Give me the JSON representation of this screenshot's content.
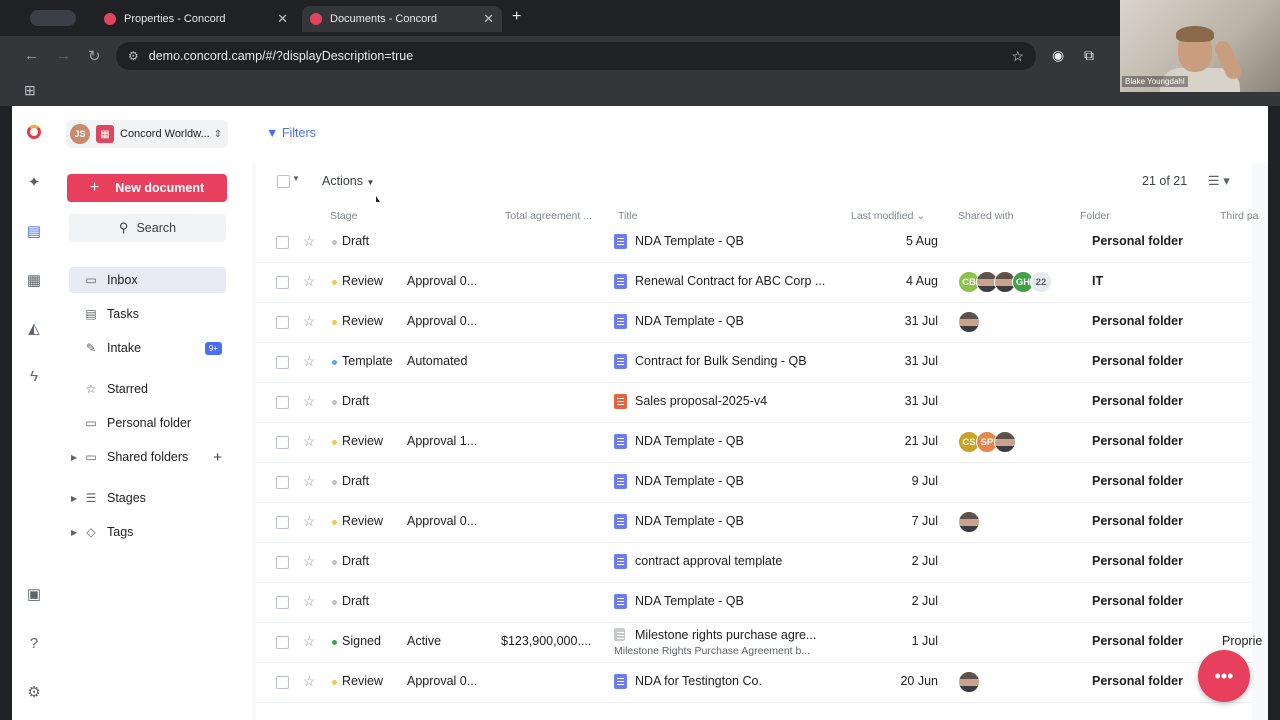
{
  "browser": {
    "tabs": [
      {
        "label": "Properties - Concord"
      },
      {
        "label": "Documents - Concord"
      }
    ],
    "url": "demo.concord.camp/#/?displayDescription=true",
    "webcam_name": "Blake Youngdahl"
  },
  "sidebar": {
    "org_initials": "JS",
    "org_name": "Concord Worldw...",
    "new_document": "New document",
    "search": "Search",
    "items": [
      {
        "label": "Inbox"
      },
      {
        "label": "Tasks"
      },
      {
        "label": "Intake",
        "badge": "9+"
      },
      {
        "label": "Starred"
      },
      {
        "label": "Personal folder"
      },
      {
        "label": "Shared folders"
      },
      {
        "label": "Stages"
      },
      {
        "label": "Tags"
      }
    ]
  },
  "main": {
    "filters": "Filters",
    "actions": "Actions",
    "count": "21 of 21",
    "headers": {
      "stage": "Stage",
      "total": "Total agreement ...",
      "title": "Title",
      "modified": "Last modified",
      "shared": "Shared with",
      "folder": "Folder",
      "third": "Third pa"
    },
    "rows": [
      {
        "stage": "Draft",
        "status": "",
        "amount": "",
        "title": "NDA Template - QB",
        "subtitle": "",
        "date": "5 Aug",
        "folder": "Personal folder"
      },
      {
        "stage": "Review",
        "status": "Approval 0...",
        "amount": "",
        "title": "Renewal Contract for ABC Corp ...",
        "subtitle": "",
        "date": "4 Aug",
        "folder": "IT",
        "shared": [
          "CB",
          "",
          "",
          "GH"
        ],
        "shared_more": "22"
      },
      {
        "stage": "Review",
        "status": "Approval 0...",
        "amount": "",
        "title": "NDA Template - QB",
        "subtitle": "",
        "date": "31 Jul",
        "folder": "Personal folder"
      },
      {
        "stage": "Template",
        "status": "Automated",
        "amount": "",
        "title": "Contract for Bulk Sending - QB",
        "subtitle": "",
        "date": "31 Jul",
        "folder": "Personal folder"
      },
      {
        "stage": "Draft",
        "status": "",
        "amount": "",
        "title": "Sales proposal-2025-v4",
        "subtitle": "",
        "date": "31 Jul",
        "folder": "Personal folder"
      },
      {
        "stage": "Review",
        "status": "Approval 1...",
        "amount": "",
        "title": "NDA Template - QB",
        "subtitle": "",
        "date": "21 Jul",
        "folder": "Personal folder",
        "shared": [
          "CS",
          "SP",
          ""
        ]
      },
      {
        "stage": "Draft",
        "status": "",
        "amount": "",
        "title": "NDA Template - QB",
        "subtitle": "",
        "date": "9 Jul",
        "folder": "Personal folder"
      },
      {
        "stage": "Review",
        "status": "Approval 0...",
        "amount": "",
        "title": "NDA Template - QB",
        "subtitle": "",
        "date": "7 Jul",
        "folder": "Personal folder"
      },
      {
        "stage": "Draft",
        "status": "",
        "amount": "",
        "title": "contract approval template",
        "subtitle": "",
        "date": "2 Jul",
        "folder": "Personal folder"
      },
      {
        "stage": "Draft",
        "status": "",
        "amount": "",
        "title": "NDA Template - QB",
        "subtitle": "",
        "date": "2 Jul",
        "folder": "Personal folder"
      },
      {
        "stage": "Signed",
        "status": "Active",
        "amount": "$123,900,000....",
        "title": "Milestone rights purchase agre...",
        "subtitle": "Milestone Rights Purchase Agreement b...",
        "date": "1 Jul",
        "folder": "Personal folder",
        "third": "Proprie"
      },
      {
        "stage": "Review",
        "status": "Approval 0...",
        "amount": "",
        "title": "NDA for Testington Co.",
        "subtitle": "",
        "date": "20 Jun",
        "folder": "Personal folder"
      }
    ]
  },
  "colors": {
    "brand": "#e8405c",
    "accent": "#4a6cf7",
    "stage_draft": "#bdc1c6",
    "stage_review": "#f2c94c",
    "stage_template": "#5aa9e6",
    "stage_signed": "#34a853"
  }
}
